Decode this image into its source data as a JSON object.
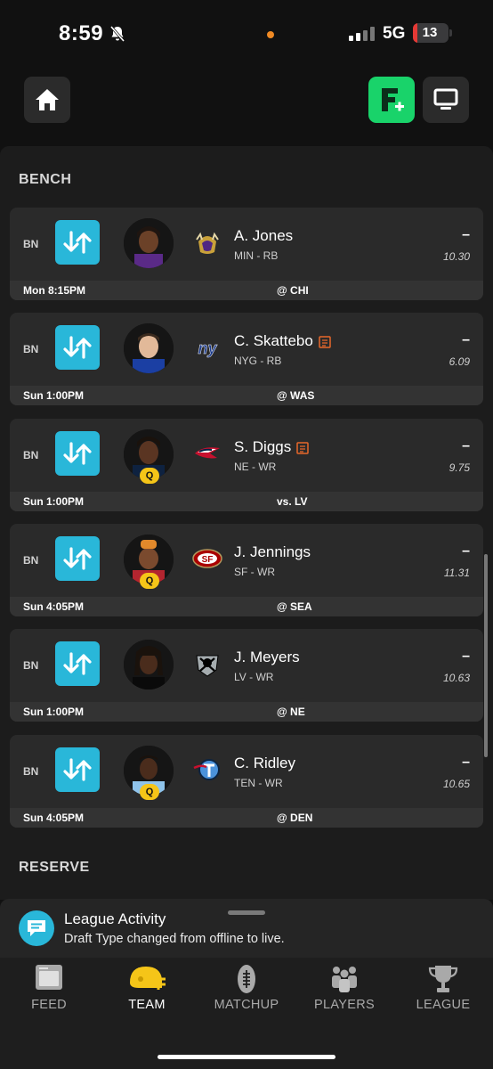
{
  "status_bar": {
    "time": "8:59",
    "network": "5G",
    "battery": "13",
    "battery_fraction": 0.13
  },
  "sections": {
    "bench": "BENCH",
    "reserve": "RESERVE"
  },
  "players": [
    {
      "slot": "BN",
      "name": "A. Jones",
      "team_pos": "MIN - RB",
      "score": "–",
      "projection": "10.30",
      "game_time": "Mon 8:15PM",
      "opponent": "@ CHI",
      "news": false,
      "status": "",
      "team_logo": "vikings-logo"
    },
    {
      "slot": "BN",
      "name": "C. Skattebo",
      "team_pos": "NYG - RB",
      "score": "–",
      "projection": "6.09",
      "game_time": "Sun 1:00PM",
      "opponent": "@ WAS",
      "news": true,
      "status": "",
      "team_logo": "giants-logo"
    },
    {
      "slot": "BN",
      "name": "S. Diggs",
      "team_pos": "NE - WR",
      "score": "–",
      "projection": "9.75",
      "game_time": "Sun 1:00PM",
      "opponent": "vs. LV",
      "news": true,
      "status": "Q",
      "team_logo": "patriots-logo"
    },
    {
      "slot": "BN",
      "name": "J. Jennings",
      "team_pos": "SF - WR",
      "score": "–",
      "projection": "11.31",
      "game_time": "Sun 4:05PM",
      "opponent": "@ SEA",
      "news": false,
      "status": "Q",
      "team_logo": "49ers-logo"
    },
    {
      "slot": "BN",
      "name": "J. Meyers",
      "team_pos": "LV - WR",
      "score": "–",
      "projection": "10.63",
      "game_time": "Sun 1:00PM",
      "opponent": "@ NE",
      "news": false,
      "status": "",
      "team_logo": "raiders-logo"
    },
    {
      "slot": "BN",
      "name": "C. Ridley",
      "team_pos": "TEN - WR",
      "score": "–",
      "projection": "10.65",
      "game_time": "Sun 4:05PM",
      "opponent": "@ DEN",
      "news": false,
      "status": "Q",
      "team_logo": "titans-logo"
    }
  ],
  "activity": {
    "title": "League Activity",
    "message": "Draft Type changed from offline to live."
  },
  "tabs": [
    {
      "label": "FEED",
      "icon": "feed-icon"
    },
    {
      "label": "TEAM",
      "icon": "helmet-icon",
      "active": true
    },
    {
      "label": "MATCHUP",
      "icon": "football-icon"
    },
    {
      "label": "PLAYERS",
      "icon": "players-icon"
    },
    {
      "label": "LEAGUE",
      "icon": "trophy-icon"
    }
  ],
  "colors": {
    "accent_blue": "#29b7d9",
    "accent_green": "#19d36a",
    "questionable": "#f5c518",
    "news_orange": "#e8682a"
  }
}
